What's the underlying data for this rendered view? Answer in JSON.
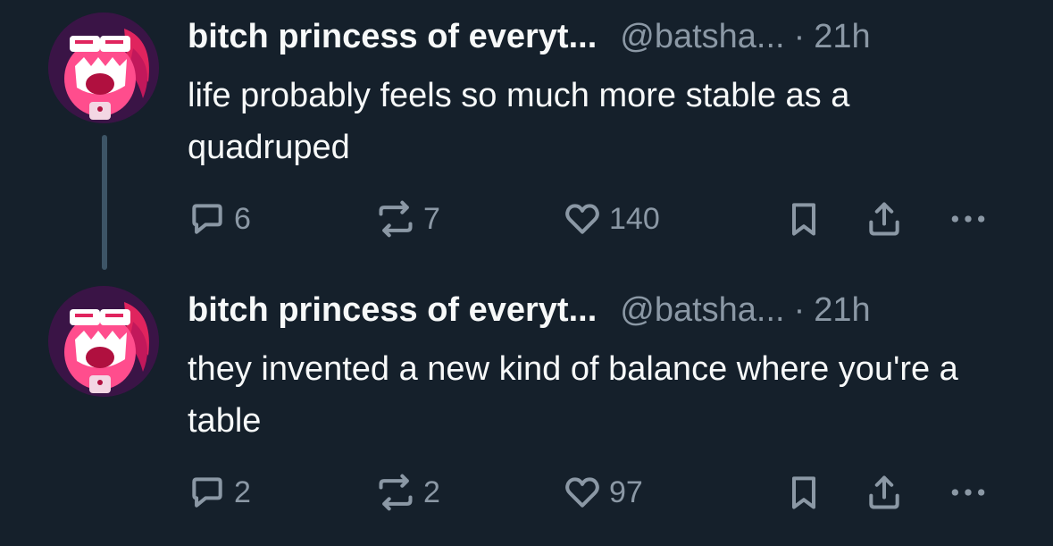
{
  "tweets": [
    {
      "display_name": "bitch princess of everyt...",
      "handle": "@batsha...",
      "separator": "·",
      "time": "21h",
      "text": "life probably feels so much more stable as a quadruped",
      "replies": "6",
      "retweets": "7",
      "likes": "140"
    },
    {
      "display_name": "bitch princess of everyt...",
      "handle": "@batsha...",
      "separator": "·",
      "time": "21h",
      "text": "they invented a new kind of balance where you're a table",
      "replies": "2",
      "retweets": "2",
      "likes": "97"
    }
  ],
  "icons": {
    "reply": "speech-bubble-icon",
    "retweet": "retweet-arrows-icon",
    "like": "heart-icon",
    "bookmark": "bookmark-icon",
    "share": "share-icon",
    "more": "more-dots-icon"
  },
  "colors": {
    "background": "#15202b",
    "primary_text": "#f7f9f9",
    "secondary_text": "#8b98a5",
    "thread_line": "#3d5466"
  }
}
